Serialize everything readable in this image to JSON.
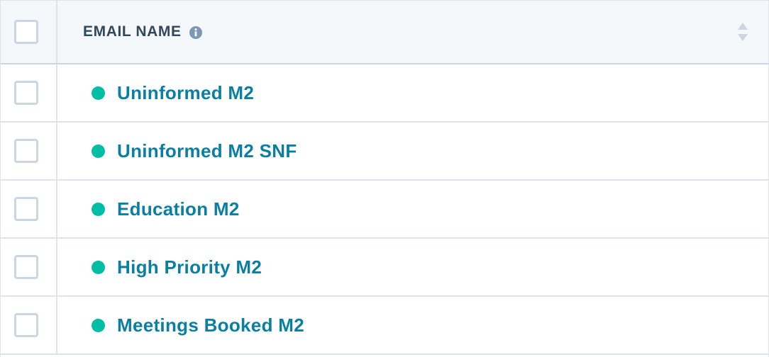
{
  "table": {
    "header": {
      "column_label": "EMAIL NAME",
      "info_icon": "info-circle-icon",
      "sort_icon": "sort-arrows-icon"
    },
    "rows": [
      {
        "name": "Uninformed M2",
        "status_color": "#00bda5"
      },
      {
        "name": "Uninformed M2 SNF",
        "status_color": "#00bda5"
      },
      {
        "name": "Education M2",
        "status_color": "#00bda5"
      },
      {
        "name": "High Priority M2",
        "status_color": "#00bda5"
      },
      {
        "name": "Meetings Booked M2",
        "status_color": "#00bda5"
      }
    ]
  },
  "colors": {
    "link": "#0a7fa2",
    "status_published": "#00bda5",
    "header_text": "#33475b",
    "border": "#dfe3eb"
  }
}
